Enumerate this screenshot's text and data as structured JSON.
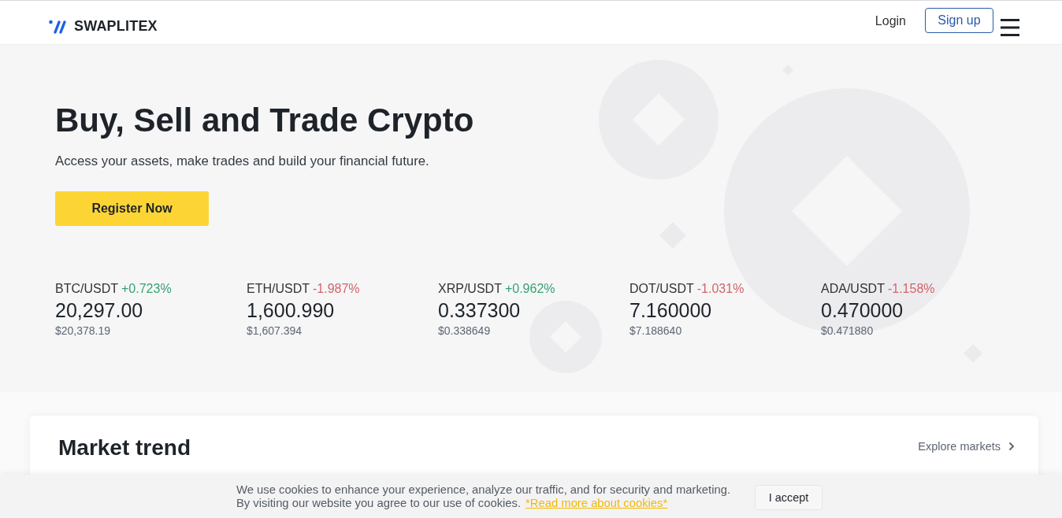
{
  "header": {
    "logo": "SWAPLITEX",
    "login": "Login",
    "signup": "Sign up"
  },
  "hero": {
    "title": "Buy, Sell and Trade Crypto",
    "subtitle": "Access your assets, make trades and build your financial future.",
    "cta": "Register Now"
  },
  "tickers": [
    {
      "pair": "BTC/USDT",
      "change": "+0.723%",
      "kind": "gain",
      "price": "20,297.00",
      "usd": "$20,378.19"
    },
    {
      "pair": "ETH/USDT",
      "change": "-1.987%",
      "kind": "loss",
      "price": "1,600.990",
      "usd": "$1,607.394"
    },
    {
      "pair": "XRP/USDT",
      "change": "+0.962%",
      "kind": "gain",
      "price": "0.337300",
      "usd": "$0.338649"
    },
    {
      "pair": "DOT/USDT",
      "change": "-1.031%",
      "kind": "loss",
      "price": "7.160000",
      "usd": "$7.188640"
    },
    {
      "pair": "ADA/USDT",
      "change": "-1.158%",
      "kind": "loss",
      "price": "0.470000",
      "usd": "$0.471880"
    }
  ],
  "market_trend": {
    "title": "Market trend",
    "link": "Explore markets"
  },
  "cookie_banner": {
    "line_1": "We use cookies to enhance your experience, analyze our traffic, and for security and marketing.",
    "line_2": "By visiting our website you agree to our use of cookies.",
    "link": "*Read more about cookies*",
    "button": "I accept"
  }
}
